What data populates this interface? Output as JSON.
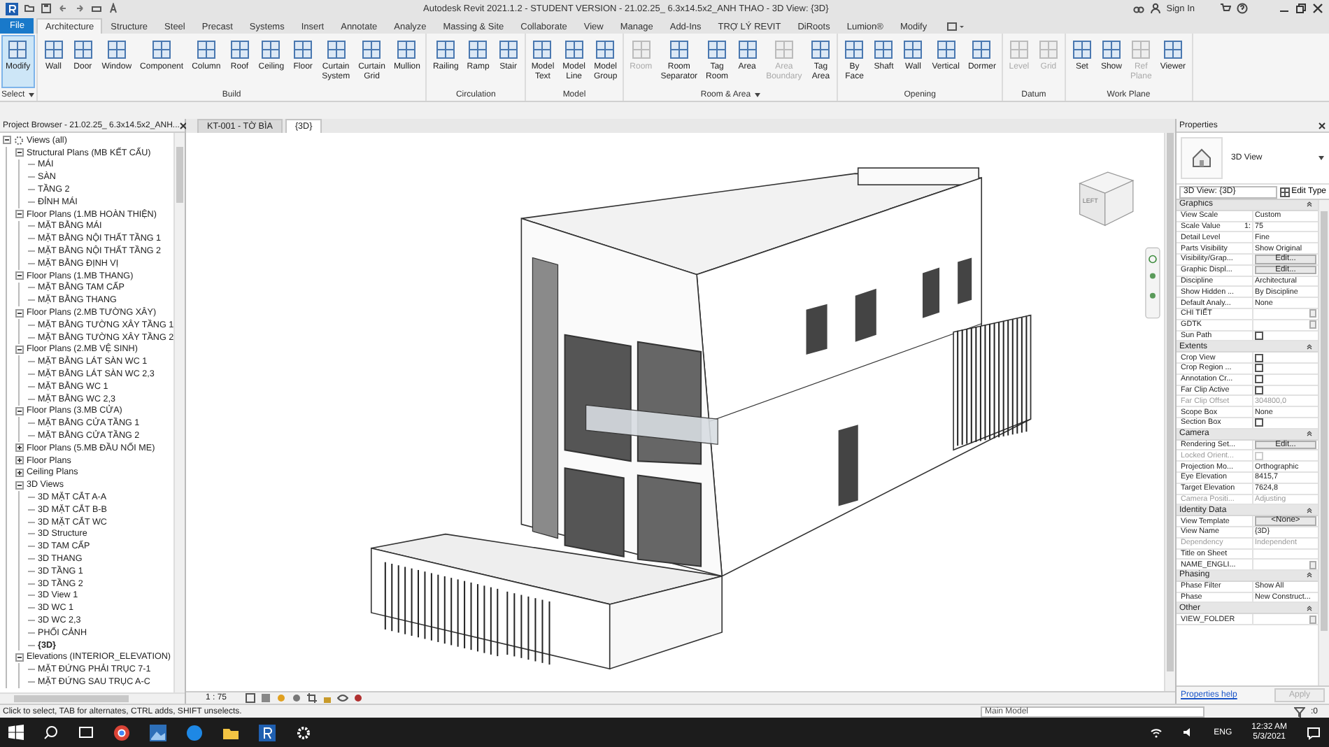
{
  "title_bar": {
    "title": "Autodesk Revit 2021.1.2 - STUDENT VERSION - 21.02.25_ 6.3x14.5x2_ANH THAO - 3D View: {3D}",
    "sign_in": "Sign In"
  },
  "ribbon": {
    "file_tab": "File",
    "tabs": [
      {
        "label": "Architecture",
        "selected": true
      },
      {
        "label": "Structure",
        "selected": false
      },
      {
        "label": "Steel",
        "selected": false
      },
      {
        "label": "Precast",
        "selected": false
      },
      {
        "label": "Systems",
        "selected": false
      },
      {
        "label": "Insert",
        "selected": false
      },
      {
        "label": "Annotate",
        "selected": false
      },
      {
        "label": "Analyze",
        "selected": false
      },
      {
        "label": "Massing & Site",
        "selected": false
      },
      {
        "label": "Collaborate",
        "selected": false
      },
      {
        "label": "View",
        "selected": false
      },
      {
        "label": "Manage",
        "selected": false
      },
      {
        "label": "Add-Ins",
        "selected": false
      },
      {
        "label": "TRỢ LÝ REVIT",
        "selected": false
      },
      {
        "label": "DiRoots",
        "selected": false
      },
      {
        "label": "Lumion®",
        "selected": false
      },
      {
        "label": "Modify",
        "selected": false
      }
    ],
    "groups": [
      {
        "label": "Select",
        "menu": true,
        "tools": [
          {
            "label": "Modify",
            "selected": true,
            "disabled": false
          }
        ]
      },
      {
        "label": "Build",
        "menu": false,
        "tools": [
          {
            "label": "Wall",
            "selected": false,
            "disabled": false
          },
          {
            "label": "Door",
            "selected": false,
            "disabled": false
          },
          {
            "label": "Window",
            "selected": false,
            "disabled": false
          },
          {
            "label": "Component",
            "selected": false,
            "disabled": false
          },
          {
            "label": "Column",
            "selected": false,
            "disabled": false
          },
          {
            "label": "Roof",
            "selected": false,
            "disabled": false
          },
          {
            "label": "Ceiling",
            "selected": false,
            "disabled": false
          },
          {
            "label": "Floor",
            "selected": false,
            "disabled": false
          },
          {
            "label": "Curtain System",
            "selected": false,
            "disabled": false
          },
          {
            "label": "Curtain Grid",
            "selected": false,
            "disabled": false
          },
          {
            "label": "Mullion",
            "selected": false,
            "disabled": false
          }
        ]
      },
      {
        "label": "Circulation",
        "menu": false,
        "tools": [
          {
            "label": "Railing",
            "selected": false,
            "disabled": false
          },
          {
            "label": "Ramp",
            "selected": false,
            "disabled": false
          },
          {
            "label": "Stair",
            "selected": false,
            "disabled": false
          }
        ]
      },
      {
        "label": "Model",
        "menu": false,
        "tools": [
          {
            "label": "Model Text",
            "selected": false,
            "disabled": false
          },
          {
            "label": "Model Line",
            "selected": false,
            "disabled": false
          },
          {
            "label": "Model Group",
            "selected": false,
            "disabled": false
          }
        ]
      },
      {
        "label": "Room & Area",
        "menu": true,
        "tools": [
          {
            "label": "Room",
            "selected": false,
            "disabled": true
          },
          {
            "label": "Room Separator",
            "selected": false,
            "disabled": false
          },
          {
            "label": "Tag Room",
            "selected": false,
            "disabled": false
          },
          {
            "label": "Area",
            "selected": false,
            "disabled": false
          },
          {
            "label": "Area Boundary",
            "selected": false,
            "disabled": true
          },
          {
            "label": "Tag Area",
            "selected": false,
            "disabled": false
          }
        ]
      },
      {
        "label": "Opening",
        "menu": false,
        "tools": [
          {
            "label": "By Face",
            "selected": false,
            "disabled": false
          },
          {
            "label": "Shaft",
            "selected": false,
            "disabled": false
          },
          {
            "label": "Wall",
            "selected": false,
            "disabled": false
          },
          {
            "label": "Vertical",
            "selected": false,
            "disabled": false
          },
          {
            "label": "Dormer",
            "selected": false,
            "disabled": false
          }
        ]
      },
      {
        "label": "Datum",
        "menu": false,
        "tools": [
          {
            "label": "Level",
            "selected": false,
            "disabled": true
          },
          {
            "label": "Grid",
            "selected": false,
            "disabled": true
          }
        ]
      },
      {
        "label": "Work Plane",
        "menu": false,
        "tools": [
          {
            "label": "Set",
            "selected": false,
            "disabled": false
          },
          {
            "label": "Show",
            "selected": false,
            "disabled": false
          },
          {
            "label": "Ref Plane",
            "selected": false,
            "disabled": true
          },
          {
            "label": "Viewer",
            "selected": false,
            "disabled": false
          }
        ]
      }
    ]
  },
  "view_tabs": [
    {
      "label": "KT-001 - TỜ BÌA",
      "selected": false
    },
    {
      "label": "{3D}",
      "selected": true
    }
  ],
  "project_browser": {
    "title": "Project Browser - 21.02.25_ 6.3x14.5x2_ANH...",
    "tree": [
      {
        "label": "Views (all)",
        "expanded": true,
        "children": [
          {
            "label": "Structural Plans (MB KẾT CẤU)",
            "expanded": true,
            "children": [
              {
                "label": "MÁI",
                "selected": false
              },
              {
                "label": "SÀN",
                "selected": false
              },
              {
                "label": "TẦNG 2",
                "selected": false
              },
              {
                "label": "ĐỈNH MÁI",
                "selected": false
              }
            ]
          },
          {
            "label": "Floor Plans (1.MB HOÀN THIỆN)",
            "expanded": true,
            "children": [
              {
                "label": "MẶT BẰNG MÁI",
                "selected": false
              },
              {
                "label": "MẶT BẰNG NỘI THẤT TẦNG 1",
                "selected": false
              },
              {
                "label": "MẶT BẰNG NỘI THẤT TẦNG 2",
                "selected": false
              },
              {
                "label": "MẶT BẰNG ĐỊNH VỊ",
                "selected": false
              }
            ]
          },
          {
            "label": "Floor Plans (1.MB THANG)",
            "expanded": true,
            "children": [
              {
                "label": "MẶT BẰNG TAM CẤP",
                "selected": false
              },
              {
                "label": "MẶT BẰNG THANG",
                "selected": false
              }
            ]
          },
          {
            "label": "Floor Plans (2.MB TƯỜNG XÂY)",
            "expanded": true,
            "children": [
              {
                "label": "MẶT BẰNG TƯỜNG XÂY TẦNG 1",
                "selected": false
              },
              {
                "label": "MẶT BẰNG TƯỜNG XÂY TẦNG 2",
                "selected": false
              }
            ]
          },
          {
            "label": "Floor Plans (2.MB VỆ SINH)",
            "expanded": true,
            "children": [
              {
                "label": "MẶT BẰNG LÁT SÀN WC 1",
                "selected": false
              },
              {
                "label": "MẶT BẰNG LÁT SÀN WC 2,3",
                "selected": false
              },
              {
                "label": "MẶT BẰNG WC 1",
                "selected": false
              },
              {
                "label": "MẶT BẰNG WC 2,3",
                "selected": false
              }
            ]
          },
          {
            "label": "Floor Plans (3.MB CỬA)",
            "expanded": true,
            "children": [
              {
                "label": "MẶT BẰNG CỬA TẦNG 1",
                "selected": false
              },
              {
                "label": "MẶT BẰNG CỬA TẦNG 2",
                "selected": false
              }
            ]
          },
          {
            "label": "Floor Plans (5.MB ĐẦU NỐI ME)",
            "expanded": false
          },
          {
            "label": "Floor Plans",
            "expanded": false
          },
          {
            "label": "Ceiling Plans",
            "expanded": false
          },
          {
            "label": "3D Views",
            "expanded": true,
            "children": [
              {
                "label": "3D MẶT CẮT A-A",
                "selected": false
              },
              {
                "label": "3D MẶT CẮT B-B",
                "selected": false
              },
              {
                "label": "3D MẶT CẮT WC",
                "selected": false
              },
              {
                "label": "3D Structure",
                "selected": false
              },
              {
                "label": "3D TAM CẤP",
                "selected": false
              },
              {
                "label": "3D THANG",
                "selected": false
              },
              {
                "label": "3D TẦNG 1",
                "selected": false
              },
              {
                "label": "3D TẦNG 2",
                "selected": false
              },
              {
                "label": "3D View 1",
                "selected": false
              },
              {
                "label": "3D WC 1",
                "selected": false
              },
              {
                "label": "3D WC 2,3",
                "selected": false
              },
              {
                "label": "PHỐI CẢNH",
                "selected": false
              },
              {
                "label": "{3D}",
                "selected": true
              }
            ]
          },
          {
            "label": "Elevations (INTERIOR_ELEVATION)",
            "expanded": true,
            "children": [
              {
                "label": "MẶT ĐỨNG PHẢI TRỤC 7-1",
                "selected": false
              },
              {
                "label": "MẶT ĐỨNG SAU TRỤC A-C",
                "selected": false
              }
            ]
          }
        ]
      }
    ]
  },
  "view": {
    "view_cube_face": "LEFT",
    "scale": "1 : 75"
  },
  "properties": {
    "title": "Properties",
    "type_name": "3D View",
    "selector": "3D View: {3D}",
    "edit_type": "Edit Type",
    "sections": [
      {
        "title": "Graphics",
        "rows": [
          {
            "label": "View Scale",
            "value": "Custom",
            "kind": "text",
            "disabled": false
          },
          {
            "label": "Scale Value",
            "prefix": "1:",
            "value": "75",
            "kind": "text",
            "disabled": false
          },
          {
            "label": "Detail Level",
            "value": "Fine",
            "kind": "text",
            "disabled": false
          },
          {
            "label": "Parts Visibility",
            "value": "Show Original",
            "kind": "text",
            "disabled": false
          },
          {
            "label": "Visibility/Grap...",
            "value": "Edit...",
            "kind": "button",
            "disabled": false
          },
          {
            "label": "Graphic Displ...",
            "value": "Edit...",
            "kind": "button",
            "disabled": false
          },
          {
            "label": "Discipline",
            "value": "Architectural",
            "kind": "text",
            "disabled": false
          },
          {
            "label": "Show Hidden ...",
            "value": "By Discipline",
            "kind": "text",
            "disabled": false
          },
          {
            "label": "Default Analy...",
            "value": "None",
            "kind": "text",
            "disabled": false
          },
          {
            "label": "CHI TIẾT",
            "kind": "browse",
            "disabled": false
          },
          {
            "label": "GDTK",
            "kind": "browse",
            "disabled": false
          },
          {
            "label": "Sun Path",
            "kind": "checkbox",
            "checked": false,
            "disabled": false
          }
        ]
      },
      {
        "title": "Extents",
        "rows": [
          {
            "label": "Crop View",
            "kind": "checkbox",
            "checked": false,
            "disabled": false
          },
          {
            "label": "Crop Region ...",
            "kind": "checkbox",
            "checked": false,
            "disabled": false
          },
          {
            "label": "Annotation Cr...",
            "kind": "checkbox",
            "checked": false,
            "disabled": false
          },
          {
            "label": "Far Clip Active",
            "kind": "checkbox",
            "checked": false,
            "disabled": false
          },
          {
            "label": "Far Clip Offset",
            "value": "304800,0",
            "kind": "text",
            "disabled": true
          },
          {
            "label": "Scope Box",
            "value": "None",
            "kind": "text",
            "disabled": false
          },
          {
            "label": "Section Box",
            "kind": "checkbox",
            "checked": false,
            "disabled": false
          }
        ]
      },
      {
        "title": "Camera",
        "rows": [
          {
            "label": "Rendering Set...",
            "value": "Edit...",
            "kind": "button",
            "disabled": false
          },
          {
            "label": "Locked Orient...",
            "kind": "checkbox",
            "checked": false,
            "disabled": true
          },
          {
            "label": "Projection Mo...",
            "value": "Orthographic",
            "kind": "text",
            "disabled": false
          },
          {
            "label": "Eye Elevation",
            "value": "8415,7",
            "kind": "text",
            "disabled": false
          },
          {
            "label": "Target Elevation",
            "value": "7624,8",
            "kind": "text",
            "disabled": false
          },
          {
            "label": "Camera Positi...",
            "value": "Adjusting",
            "kind": "text",
            "disabled": true
          }
        ]
      },
      {
        "title": "Identity Data",
        "rows": [
          {
            "label": "View Template",
            "value": "<None>",
            "kind": "button",
            "disabled": false
          },
          {
            "label": "View Name",
            "value": "{3D}",
            "kind": "text",
            "disabled": false
          },
          {
            "label": "Dependency",
            "value": "Independent",
            "kind": "text",
            "disabled": true
          },
          {
            "label": "Title on Sheet",
            "kind": "text",
            "disabled": false
          },
          {
            "label": "NAME_ENGLI...",
            "kind": "browse",
            "disabled": false
          }
        ]
      },
      {
        "title": "Phasing",
        "rows": [
          {
            "label": "Phase Filter",
            "value": "Show All",
            "kind": "text",
            "disabled": false
          },
          {
            "label": "Phase",
            "value": "New Construct...",
            "kind": "text",
            "disabled": false
          }
        ]
      },
      {
        "title": "Other",
        "rows": [
          {
            "label": "VIEW_FOLDER",
            "kind": "browse",
            "disabled": false
          }
        ]
      }
    ],
    "help_link": "Properties help",
    "apply": {
      "label": "Apply",
      "disabled": true
    }
  },
  "status_bar": {
    "hint": "Click to select, TAB for alternates, CTRL adds, SHIFT unselects.",
    "workset": "Main Model",
    "selection_count": ":0"
  },
  "taskbar": {
    "language": "ENG",
    "time": "12:32 AM",
    "date": "5/3/2021"
  }
}
